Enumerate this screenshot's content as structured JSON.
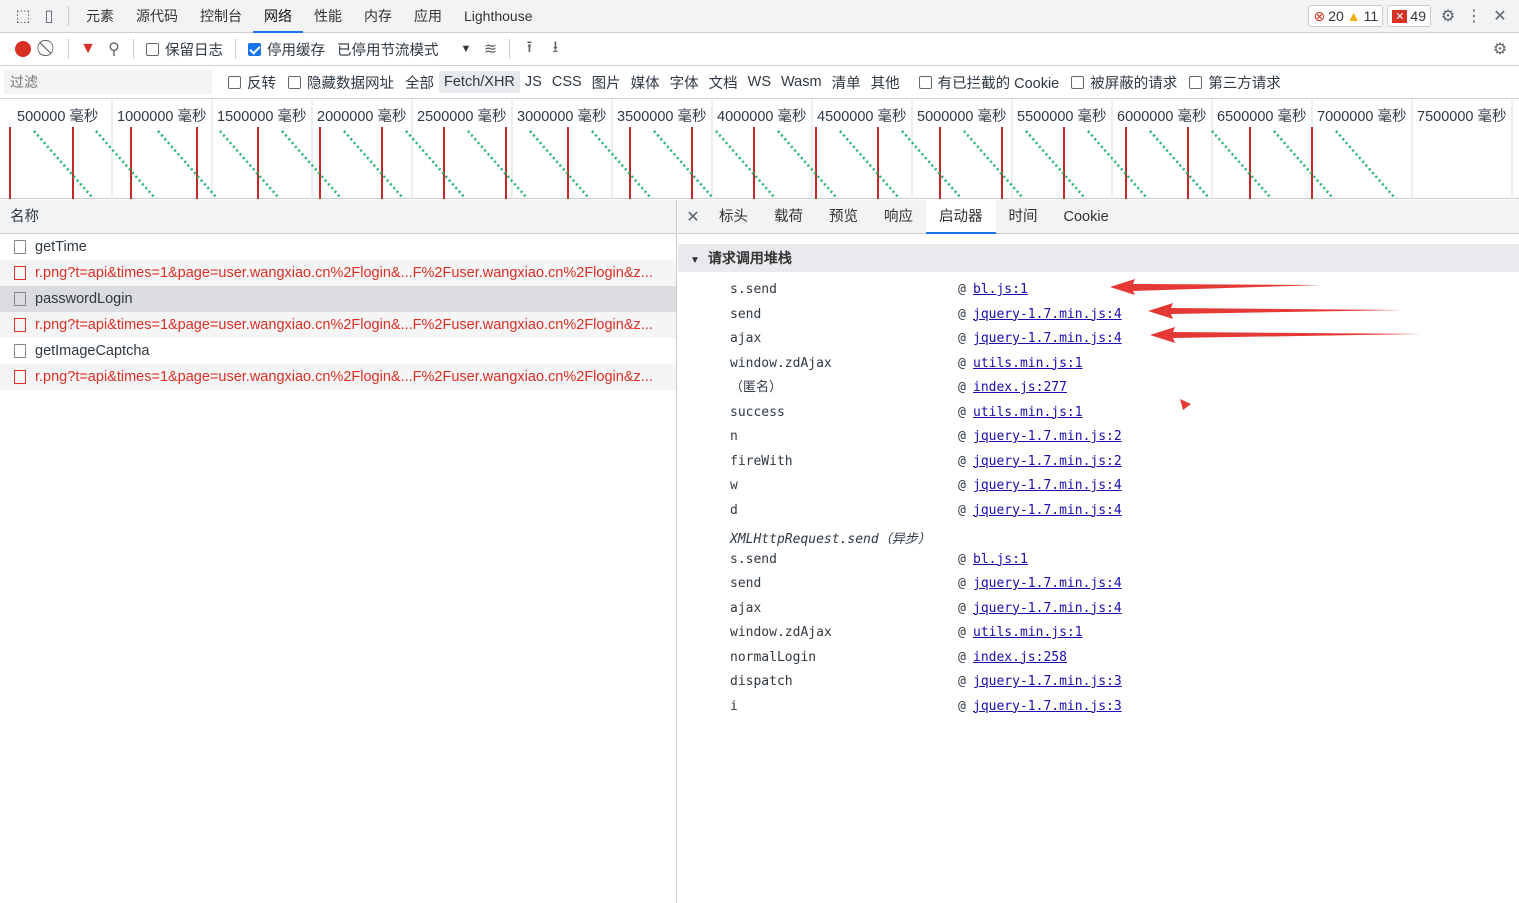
{
  "topbar": {
    "tabs": [
      "元素",
      "源代码",
      "控制台",
      "网络",
      "性能",
      "内存",
      "应用",
      "Lighthouse"
    ],
    "active_tab": "网络",
    "errors": "20",
    "warnings": "11",
    "issues": "49"
  },
  "toolbar": {
    "preserve_log": "保留日志",
    "disable_cache": "停用缓存",
    "throttle": "已停用节流模式"
  },
  "filterbar": {
    "filter_placeholder": "过滤",
    "invert": "反转",
    "hide_data_urls": "隐藏数据网址",
    "types": [
      "全部",
      "Fetch/XHR",
      "JS",
      "CSS",
      "图片",
      "媒体",
      "字体",
      "文档",
      "WS",
      "Wasm",
      "清单",
      "其他"
    ],
    "selected_type": "Fetch/XHR",
    "blocked_cookies": "有已拦截的 Cookie",
    "blocked_requests": "被屏蔽的请求",
    "third_party": "第三方请求"
  },
  "overview": {
    "ticks": [
      "500000 毫秒",
      "1000000 毫秒",
      "1500000 毫秒",
      "2000000 毫秒",
      "2500000 毫秒",
      "3000000 毫秒",
      "3500000 毫秒",
      "4000000 毫秒",
      "4500000 毫秒",
      "5000000 毫秒",
      "5500000 毫秒",
      "6000000 毫秒",
      "6500000 毫秒",
      "7000000 毫秒",
      "7500000 毫秒"
    ]
  },
  "requests": {
    "header": "名称",
    "rows": [
      {
        "name": "getTime",
        "error": false
      },
      {
        "name": "r.png?t=api&times=1&page=user.wangxiao.cn%2Flogin&...F%2Fuser.wangxiao.cn%2Flogin&z...",
        "error": true
      },
      {
        "name": "passwordLogin",
        "error": false
      },
      {
        "name": "r.png?t=api&times=1&page=user.wangxiao.cn%2Flogin&...F%2Fuser.wangxiao.cn%2Flogin&z...",
        "error": true
      },
      {
        "name": "getImageCaptcha",
        "error": false
      },
      {
        "name": "r.png?t=api&times=1&page=user.wangxiao.cn%2Flogin&...F%2Fuser.wangxiao.cn%2Flogin&z...",
        "error": true
      }
    ]
  },
  "details": {
    "tabs": [
      "标头",
      "载荷",
      "预览",
      "响应",
      "启动器",
      "时间",
      "Cookie"
    ],
    "active_tab": "启动器",
    "section_title": "请求调用堆栈",
    "frames_1": [
      {
        "fn": "s.send",
        "loc": "bl.js:1"
      },
      {
        "fn": "send",
        "loc": "jquery-1.7.min.js:4"
      },
      {
        "fn": "ajax",
        "loc": "jquery-1.7.min.js:4"
      },
      {
        "fn": "window.zdAjax",
        "loc": "utils.min.js:1"
      },
      {
        "fn": "（匿名）",
        "loc": "index.js:277"
      },
      {
        "fn": "success",
        "loc": "utils.min.js:1"
      },
      {
        "fn": "n",
        "loc": "jquery-1.7.min.js:2"
      },
      {
        "fn": "fireWith",
        "loc": "jquery-1.7.min.js:2"
      },
      {
        "fn": "w",
        "loc": "jquery-1.7.min.js:4"
      },
      {
        "fn": "d",
        "loc": "jquery-1.7.min.js:4"
      }
    ],
    "async_label": "XMLHttpRequest.send（异步）",
    "frames_2": [
      {
        "fn": "s.send",
        "loc": "bl.js:1"
      },
      {
        "fn": "send",
        "loc": "jquery-1.7.min.js:4"
      },
      {
        "fn": "ajax",
        "loc": "jquery-1.7.min.js:4"
      },
      {
        "fn": "window.zdAjax",
        "loc": "utils.min.js:1"
      },
      {
        "fn": "normalLogin",
        "loc": "index.js:258"
      },
      {
        "fn": "dispatch",
        "loc": "jquery-1.7.min.js:3"
      },
      {
        "fn": "i",
        "loc": "jquery-1.7.min.js:3"
      }
    ]
  },
  "colors": {
    "accent": "#1a73e8",
    "error": "#d93025",
    "annotation_arrow": "#e53935"
  }
}
